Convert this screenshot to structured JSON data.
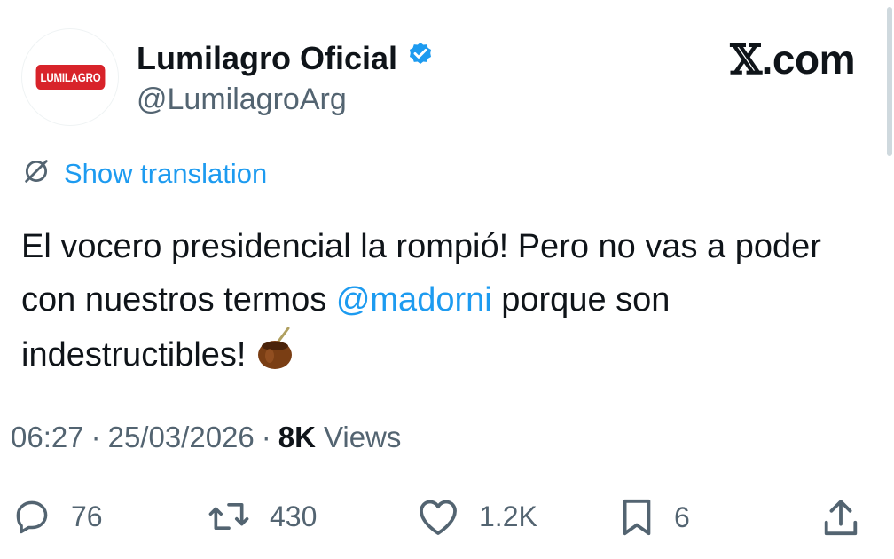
{
  "account": {
    "display_name": "Lumilagro Oficial",
    "handle": "@LumilagroArg",
    "logo_text": "LUMILAGRO",
    "verified_icon": "verified-badge-icon"
  },
  "brand": {
    "x": "𝕏",
    "suffix": ".com"
  },
  "translation": {
    "icon": "globe-slash-icon",
    "label": "Show translation"
  },
  "tweet": {
    "text_before": "El vocero presidencial la rompió! Pero no vas a poder con nuestros termos ",
    "mention": "@madorni",
    "text_after": " porque son indestructibles!",
    "emoji": "mate-emoji"
  },
  "meta": {
    "time": "06:27",
    "separator": "·",
    "date": "25/03/2026",
    "views_count": "8K",
    "views_label": "Views"
  },
  "actions": {
    "replies": "76",
    "reposts": "430",
    "likes": "1.2K",
    "bookmarks": "6"
  },
  "colors": {
    "accent": "#1d9bf0",
    "muted": "#536471",
    "text": "#0f1419",
    "logo_red": "#d8232a"
  }
}
